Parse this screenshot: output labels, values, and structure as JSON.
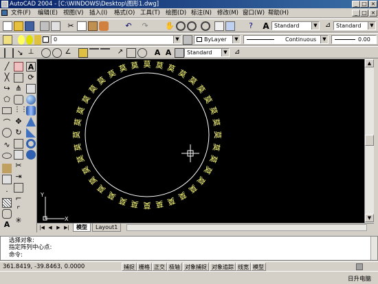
{
  "window": {
    "title": "AutoCAD 2004 - [C:\\WINDOWS\\Desktop\\图形1.dwg]",
    "app_icon": "autocad-icon",
    "controls": [
      "_",
      "□",
      "×"
    ],
    "doc_controls": [
      "_",
      "□",
      "×"
    ]
  },
  "menu": {
    "items": [
      "文件(F)",
      "编辑(E)",
      "视图(V)",
      "插入(I)",
      "格式(O)",
      "工具(T)",
      "绘图(D)",
      "标注(N)",
      "修改(M)",
      "窗口(W)",
      "帮助(H)"
    ]
  },
  "toolbar_standard": {
    "text_style": "Standard",
    "dim_style": "Standard"
  },
  "toolbar_layers": {
    "layer_name": "0",
    "color": "ByLayer",
    "linetype": "Continuous",
    "lineweight": "0.00"
  },
  "toolbar_dim": {
    "dim_style_combo": "Standard"
  },
  "drawing": {
    "ring_text": [
      "莫",
      "莫",
      "莫",
      "莫",
      "莫",
      "莫",
      "莫",
      "莫",
      "莫",
      "莫",
      "莫",
      "莫",
      "莫",
      "莫",
      "莫",
      "莫",
      "莫",
      "莫",
      "莫",
      "莫",
      "莫",
      "莫",
      "莫",
      "莫",
      "莫",
      "莫",
      "莫",
      "莫",
      "莫",
      "莫",
      "莫",
      "莫",
      "莫",
      "莫",
      "莫",
      "莫"
    ],
    "ucs_x": "X",
    "ucs_y": "Y",
    "text_color": "#ffff80",
    "circle_color": "#ffffff"
  },
  "tabs": {
    "model": "模型",
    "layout1": "Layout1"
  },
  "command": {
    "lines": [
      "选择对象:",
      "指定阵列中心点:",
      "命令:"
    ]
  },
  "status": {
    "coords": "361.8419, -39.8463, 0.0000",
    "buttons": [
      "捕捉",
      "栅格",
      "正交",
      "极轴",
      "对象捕捉",
      "对象追踪",
      "线宽",
      "模型"
    ]
  },
  "taskbar": {
    "tray_text": "日升电脑"
  }
}
